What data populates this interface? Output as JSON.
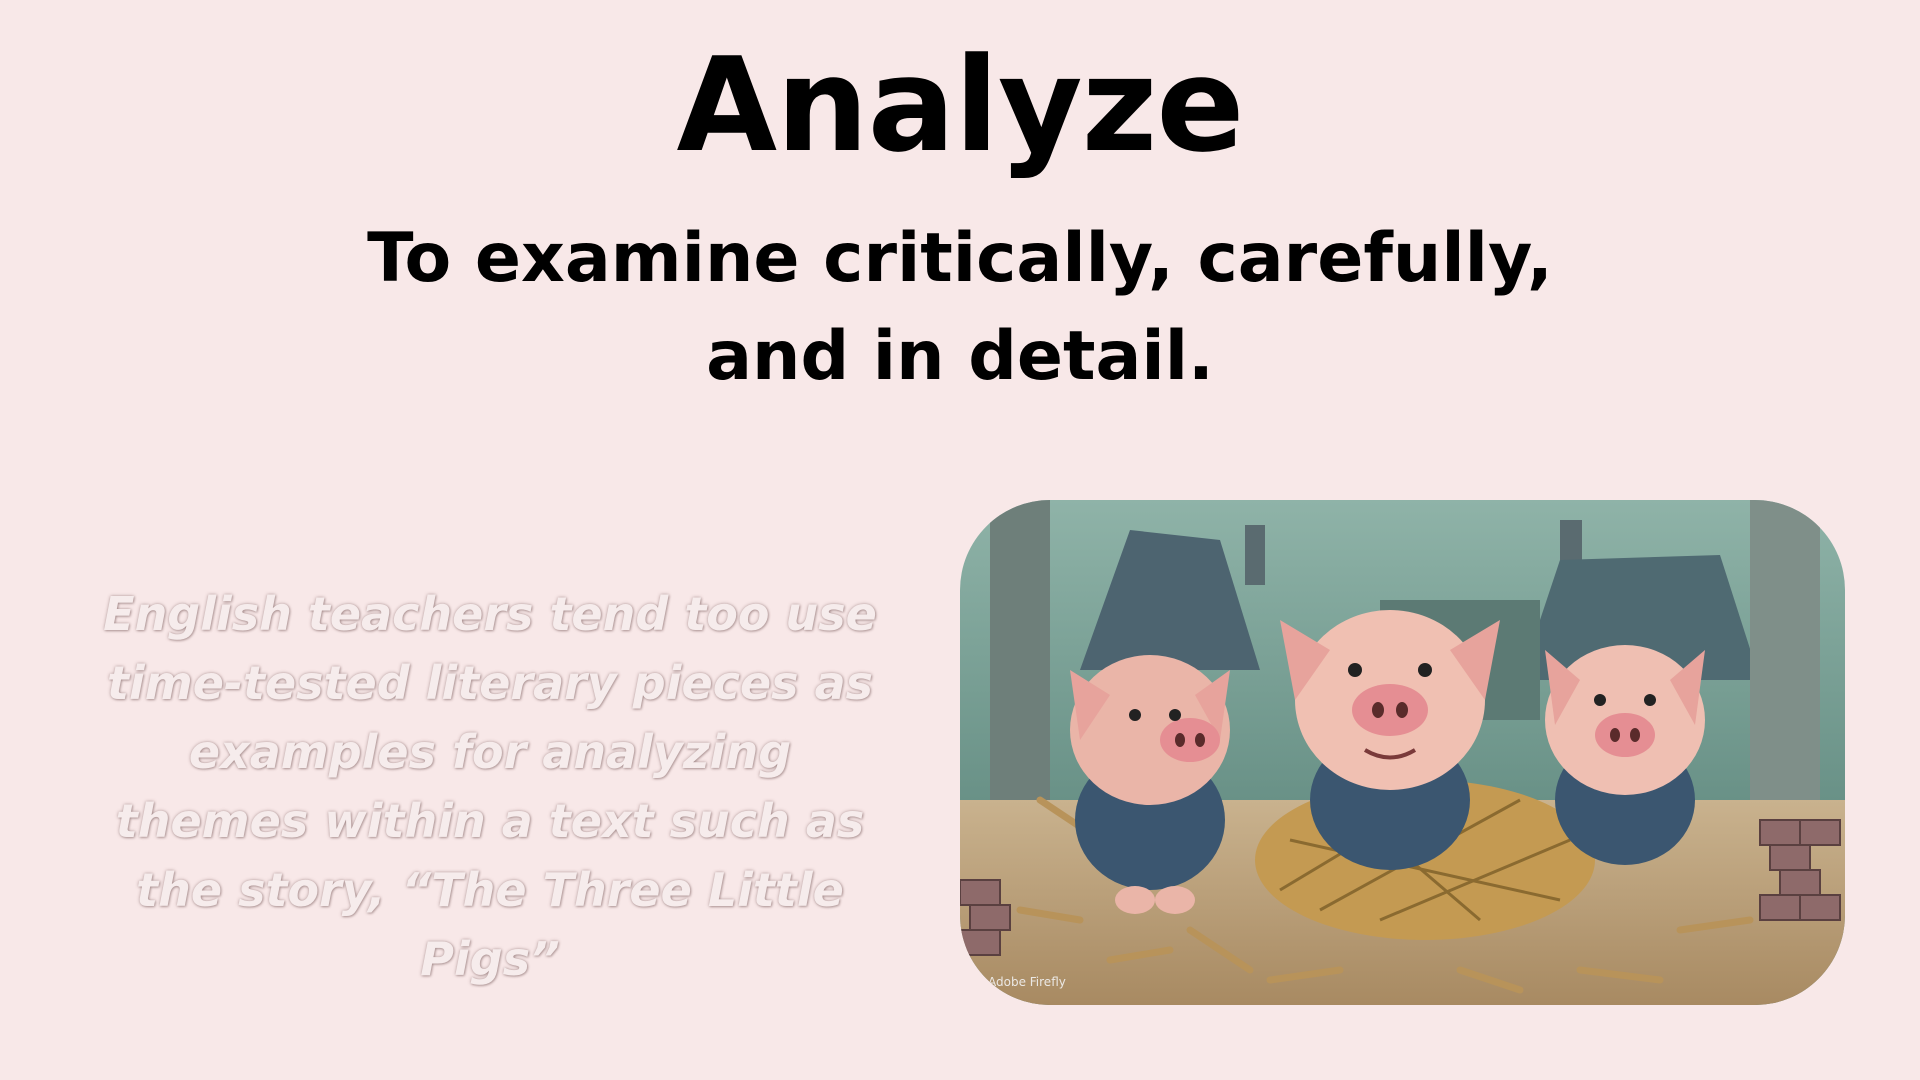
{
  "slide": {
    "title": "Analyze",
    "definition": "To examine critically, carefully, and in detail.",
    "body_text": "English teachers tend too use time-tested literary pieces as examples for analyzing themes within a text such as the story, “The Three Little Pigs”"
  },
  "illustration": {
    "subject": "three-little-pigs",
    "watermark": "Adobe Firefly"
  },
  "colors": {
    "background": "#f8e8e8",
    "title_text": "#000000",
    "body_text": "#f6ecec"
  }
}
